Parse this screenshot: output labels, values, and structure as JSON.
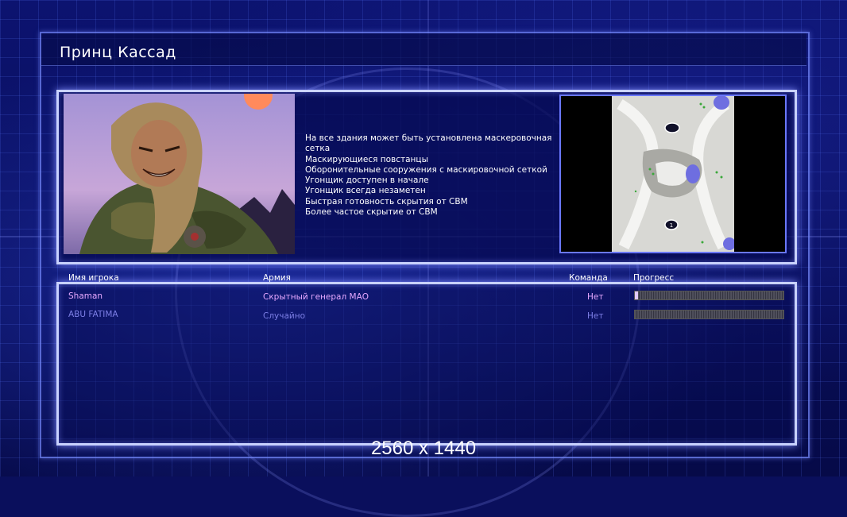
{
  "header": {
    "title": "Принц Кассад"
  },
  "general": {
    "portrait": "general-portrait",
    "features": [
      "На все здания может быть установлена маскеровочная",
      " сетка",
      "Маскирующиеся повстанцы",
      "Оборонительные сооружения с маскировочной сеткой",
      "Угонщик доступен в начале",
      "Угонщик всегда незаметен",
      "Быстрая готовность скрытия от СВМ",
      "Более частое скрытие от СВМ"
    ]
  },
  "map": {
    "marker_label": "1"
  },
  "table": {
    "headers": {
      "player": "Имя игрока",
      "army": "Армия",
      "team": "Команда",
      "progress": "Прогресс"
    },
    "rows": [
      {
        "player": "Shaman",
        "army": "Скрытный генерал МАО",
        "team": "Нет",
        "progress": 0.02
      },
      {
        "player": "ABU FATIMA",
        "army": "Случайно",
        "team": "Нет",
        "progress": 0
      }
    ]
  },
  "footer": {
    "resolution": "2560 x 1440"
  },
  "colors": {
    "panel_border": "#c9d2ff",
    "row1_text": "#e6a8ff",
    "row2_text": "#7d7fe6"
  }
}
